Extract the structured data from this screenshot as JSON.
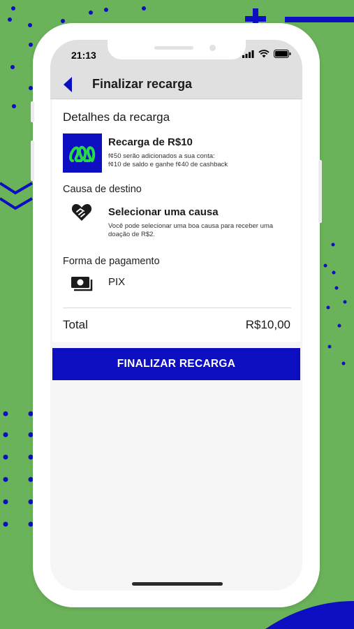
{
  "colors": {
    "background": "#6ab35a",
    "accent_blue": "#0d0dc2",
    "logo_green": "#29d94a"
  },
  "status_bar": {
    "time": "21:13",
    "icons": [
      "signal-icon",
      "wifi-icon",
      "battery-icon"
    ]
  },
  "nav": {
    "back_icon": "chevron-left-icon",
    "title": "Finalizar recarga"
  },
  "details": {
    "heading": "Detalhes da recarga",
    "recharge": {
      "icon": "app-logo-icon",
      "title": "Recarga de R$10",
      "line1": "f¢50 serão adicionados a sua conta:",
      "line2": "f¢10 de saldo e ganhe f¢40 de cashback"
    }
  },
  "cause": {
    "heading": "Causa de destino",
    "icon": "heart-handshake-icon",
    "title": "Selecionar uma causa",
    "description": "Você pode selecionar uma boa causa para receber uma doação de R$2."
  },
  "payment": {
    "heading": "Forma de pagamento",
    "icon": "cash-icon",
    "method": "PIX"
  },
  "summary": {
    "total_label": "Total",
    "total_value": "R$10,00"
  },
  "cta": {
    "label": "FINALIZAR RECARGA"
  }
}
